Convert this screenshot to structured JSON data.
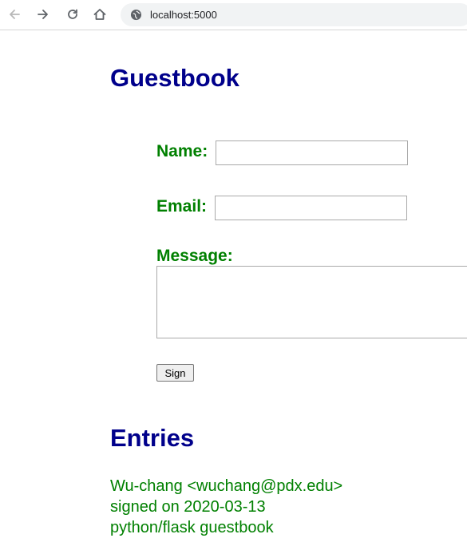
{
  "browser": {
    "url": "localhost:5000"
  },
  "page": {
    "title": "Guestbook",
    "form": {
      "name_label": "Name:",
      "name_value": "",
      "email_label": "Email:",
      "email_value": "",
      "message_label": "Message:",
      "message_value": "",
      "submit_label": "Sign"
    },
    "entries_title": "Entries",
    "entries": [
      {
        "author_line": "Wu-chang <wuchang@pdx.edu>",
        "date_line": "signed on 2020-03-13",
        "message": "python/flask guestbook"
      }
    ]
  },
  "colors": {
    "heading": "#00008b",
    "label": "#008000",
    "entry_text": "#008000"
  }
}
